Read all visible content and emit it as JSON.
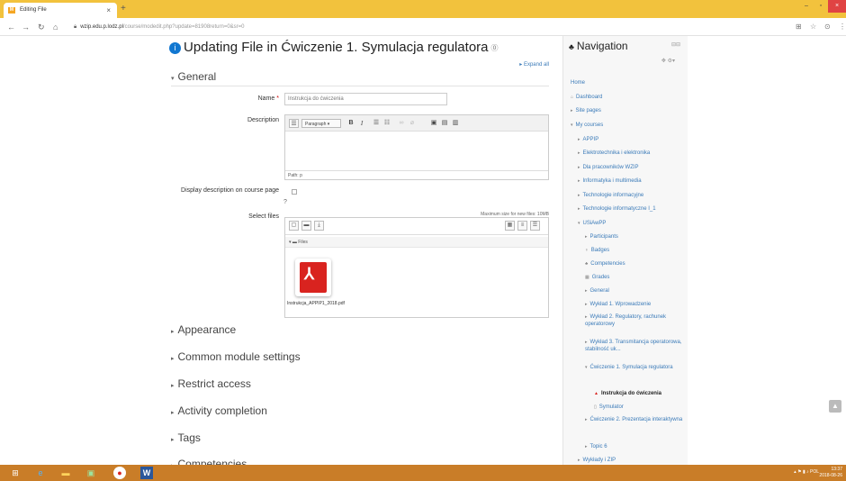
{
  "browser": {
    "tab_title": "Editing File",
    "tab_close": "×",
    "new_tab": "+",
    "url_host": "wzip.edu.p.lodz.pl",
    "url_path": "/course/modedit.php?update=81908return=0&sr=0",
    "win_min": "–",
    "win_max": "▫",
    "win_close": "×"
  },
  "page": {
    "heading": "Updating File in Ćwiczenie 1. Symulacja regulatora",
    "expand_all": "Expand all",
    "general_header": "General",
    "name_label": "Name",
    "name_required": "*",
    "name_value": "Instrukcja do ćwiczenia",
    "description_label": "Description",
    "editor_paragraph": "Paragraph",
    "editor_path": "Path: p",
    "display_label": "Display description on course page",
    "select_files_label": "Select files",
    "max_size": "Maximum size for new files: 10MB",
    "files_path": "Files",
    "file_name": "Instrukcja_APPIP1_2018.pdf",
    "sections": [
      "Appearance",
      "Common module settings",
      "Restrict access",
      "Activity completion",
      "Tags",
      "Competencies"
    ]
  },
  "navigation": {
    "title": "Navigation",
    "items": [
      "Home",
      "Dashboard",
      "Site pages",
      "My courses",
      "APPIP",
      "Elektrotechnika i elektronika",
      "Dla pracowników WZIP",
      "Informatyka i multimedia",
      "Technologie informacyjne",
      "Technologie informatyczne I_1",
      "USiAwPP",
      "Participants",
      "Badges",
      "Competencies",
      "Grades",
      "General",
      "Wykład 1. Wprowadzenie",
      "Wykład 2. Regulatory, rachunek operatorowy",
      "Wykład 3. Transmitancja operatorowa, stabilność uk...",
      "Ćwiczenie 1. Symulacja regulatora",
      "Instrukcja do ćwiczenia",
      "Symulator",
      "Ćwiczenie 2. Prezentacja interaktywna",
      "Topic 6",
      "Wykłady i ZIP"
    ]
  },
  "taskbar": {
    "lang": "POL",
    "time": "13:37",
    "date": "2018-08-26"
  }
}
